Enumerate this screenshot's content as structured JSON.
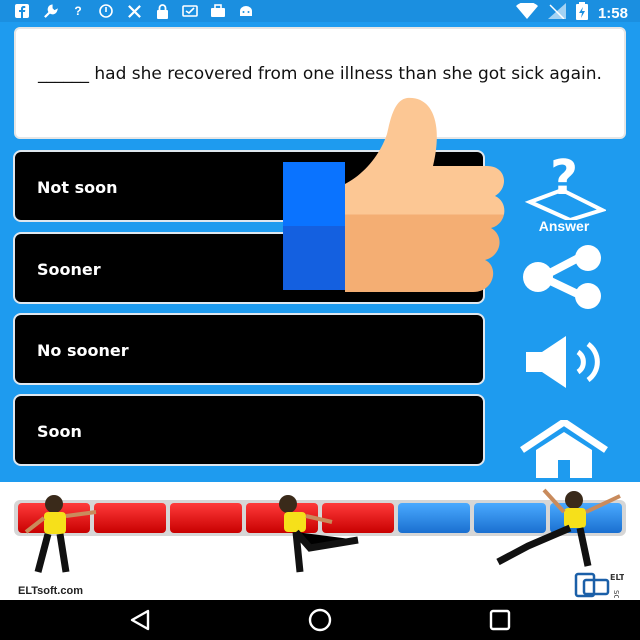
{
  "status_bar": {
    "time": "1:58",
    "left_icons": [
      "facebook-icon",
      "wrench-icon",
      "question-icon",
      "dnd-icon",
      "tools-icon",
      "lock-icon",
      "cast-icon",
      "briefcase-icon",
      "android-icon"
    ],
    "right_icons": [
      "wifi-icon",
      "signal-icon",
      "battery-icon"
    ]
  },
  "question": {
    "text": "______ had she recovered from one illness than she got sick again."
  },
  "options": [
    {
      "label": "Not soon"
    },
    {
      "label": "Sooner"
    },
    {
      "label": "No sooner"
    },
    {
      "label": "Soon"
    }
  ],
  "side_buttons": {
    "answer_label": "Answer"
  },
  "progress": {
    "segments": [
      "red",
      "red",
      "red",
      "red",
      "red",
      "blue",
      "blue",
      "blue"
    ]
  },
  "banner": {
    "brand_text": "ELTsoft.com",
    "logo_text": "ELT SOFT"
  },
  "colors": {
    "background": "#1e9bef",
    "option_bg": "#000000",
    "red_segment": "#e00000",
    "blue_segment": "#2a86e6"
  }
}
